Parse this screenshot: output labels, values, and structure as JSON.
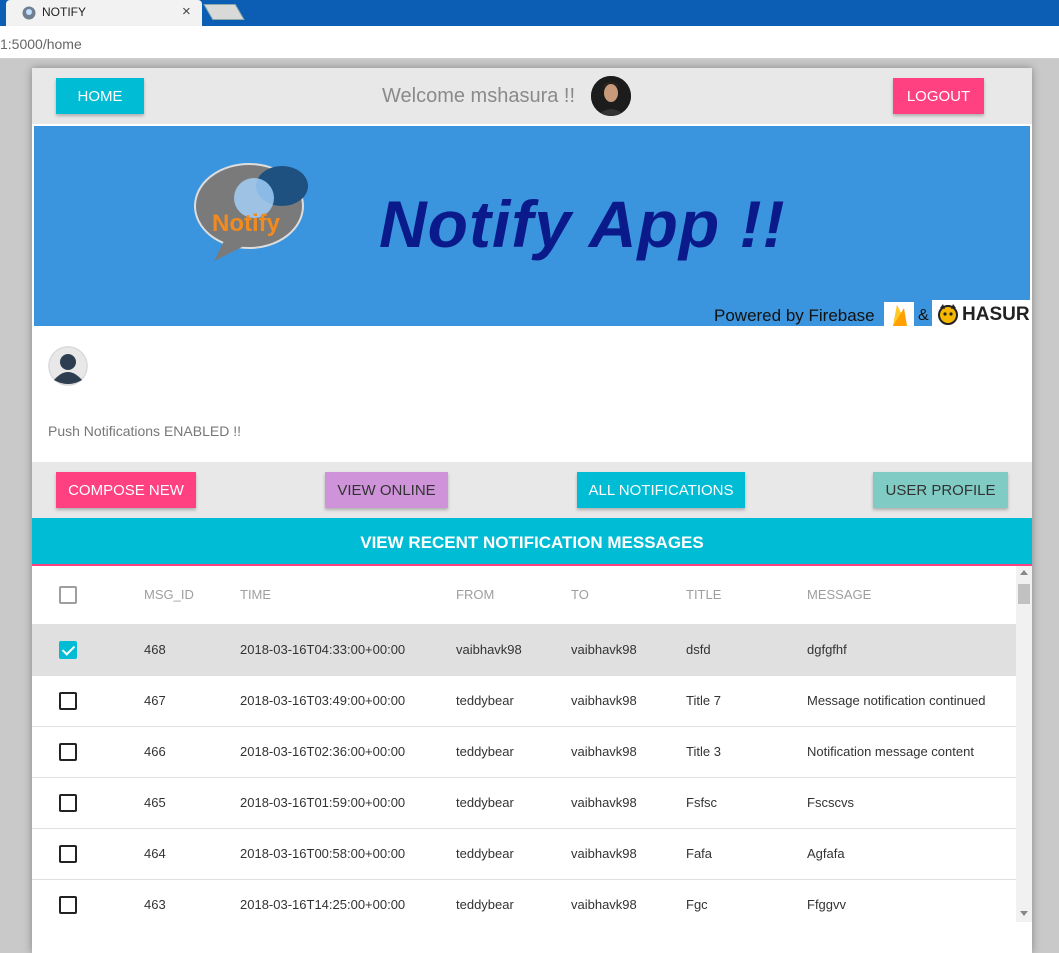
{
  "browser": {
    "tab_title": "NOTIFY",
    "tab_close": "×",
    "url": "1:5000/home"
  },
  "header": {
    "home_label": "HOME",
    "welcome_text": "Welcome mshasura !!",
    "logout_label": "LOGOUT"
  },
  "banner": {
    "logo_text": "Notify",
    "title": "Notify App !!",
    "powered_by": "Powered by Firebase",
    "ampersand": "&",
    "hasura": "HASURA"
  },
  "profile": {
    "push_status": "Push Notifications ENABLED !!"
  },
  "actions": {
    "compose": "COMPOSE NEW",
    "online": "VIEW ONLINE",
    "all": "ALL NOTIFICATIONS",
    "user_profile": "USER PROFILE"
  },
  "section_title": "VIEW RECENT NOTIFICATION MESSAGES",
  "table": {
    "columns": [
      "MSG_ID",
      "TIME",
      "FROM",
      "TO",
      "TITLE",
      "MESSAGE"
    ],
    "rows": [
      {
        "checked": true,
        "msg_id": "468",
        "time": "2018-03-16T04:33:00+00:00",
        "from": "vaibhavk98",
        "to": "vaibhavk98",
        "title": "dsfd",
        "message": "dgfgfhf"
      },
      {
        "checked": false,
        "msg_id": "467",
        "time": "2018-03-16T03:49:00+00:00",
        "from": "teddybear",
        "to": "vaibhavk98",
        "title": "Title 7",
        "message": "Message notification continued"
      },
      {
        "checked": false,
        "msg_id": "466",
        "time": "2018-03-16T02:36:00+00:00",
        "from": "teddybear",
        "to": "vaibhavk98",
        "title": "Title 3",
        "message": "Notification message content"
      },
      {
        "checked": false,
        "msg_id": "465",
        "time": "2018-03-16T01:59:00+00:00",
        "from": "teddybear",
        "to": "vaibhavk98",
        "title": "Fsfsc",
        "message": "Fscscvs"
      },
      {
        "checked": false,
        "msg_id": "464",
        "time": "2018-03-16T00:58:00+00:00",
        "from": "teddybear",
        "to": "vaibhavk98",
        "title": "Fafa",
        "message": "Agfafa"
      },
      {
        "checked": false,
        "msg_id": "463",
        "time": "2018-03-16T14:25:00+00:00",
        "from": "teddybear",
        "to": "vaibhavk98",
        "title": "Fgc",
        "message": "Ffggvv"
      }
    ]
  },
  "colors": {
    "primary": "#00bcd4",
    "accent": "#ff4081",
    "purple": "#ce93d8",
    "teal": "#80cbc4",
    "banner_bg": "#3a95de",
    "banner_title": "#0b1a8a"
  }
}
